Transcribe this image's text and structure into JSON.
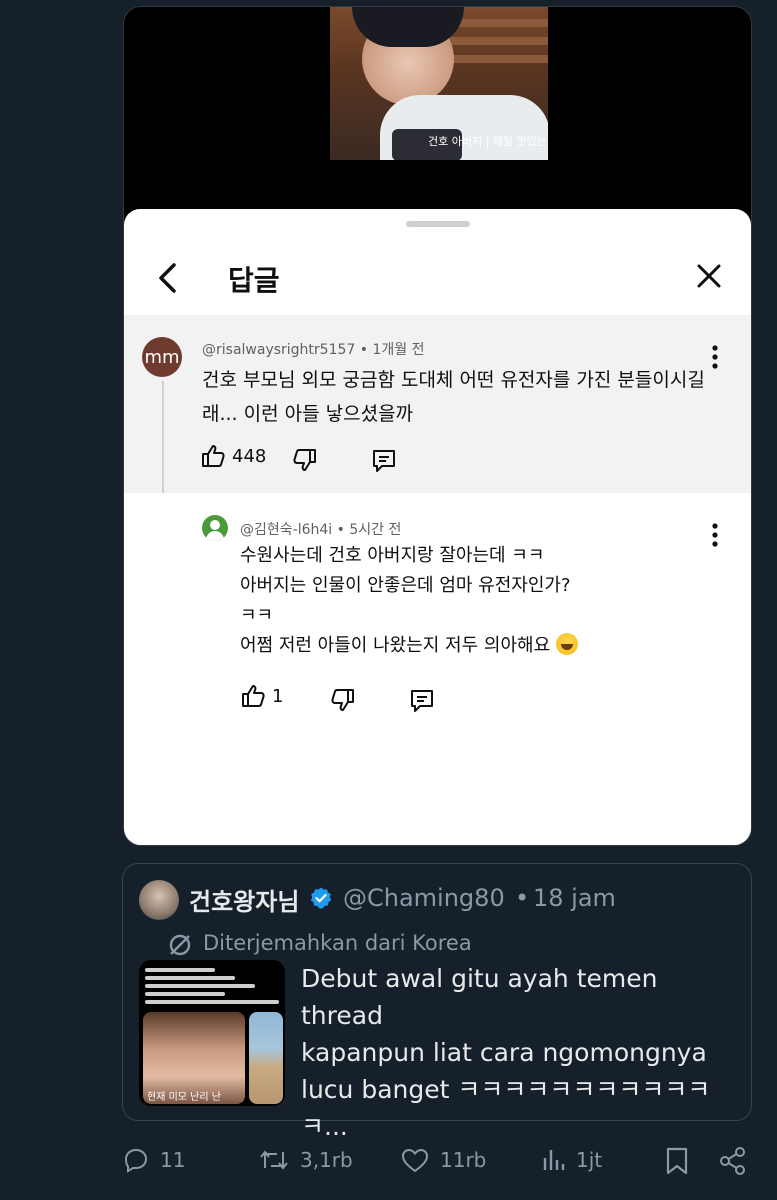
{
  "video": {
    "caption": "건호 아버지 | 제일 맛있는"
  },
  "sheet": {
    "title": "답글"
  },
  "comment": {
    "avatar_initials": "mm",
    "author": "@risalwaysrightr5157",
    "time": "1개월 전",
    "line1": "건호 부모님 외모 궁금함 도대체 어떤 유전자를 가진 분들이시길",
    "line2": "래... 이런 아들 낳으셨을까",
    "likes": "448"
  },
  "reply": {
    "author": "@김현숙-l6h4i",
    "time": "5시간 전",
    "line1": "수원사는데 건호 아버지랑 잘아는데 ㅋㅋ",
    "line2": "아버지는 인물이 안좋은데 엄마 유전자인가?",
    "line3": "ㅋㅋ",
    "line4": "어쩜 저런 아들이 나왔는지 저두 의아해요",
    "likes": "1"
  },
  "quote": {
    "name": "건호왕자님",
    "handle": "@Chaming80",
    "separator": "•",
    "time": "18 jam",
    "translated_label": "Diterjemahkan dari Korea",
    "thumb_caption": "현재 미모 난리 난",
    "text_line1": "Debut awal gitu ayah temen thread",
    "text_line2": "kapanpun liat cara ngomongnya",
    "text_line3": "lucu banget ㅋㅋㅋㅋㅋㅋㅋㅋㅋㅋㅋㅋ..."
  },
  "actions": {
    "replies": "11",
    "retweets": "3,1rb",
    "likes": "11rb",
    "views": "1jt"
  },
  "colors": {
    "background": "#15202b",
    "verified": "#1d9bf0",
    "muted_text": "#8b98a5"
  }
}
